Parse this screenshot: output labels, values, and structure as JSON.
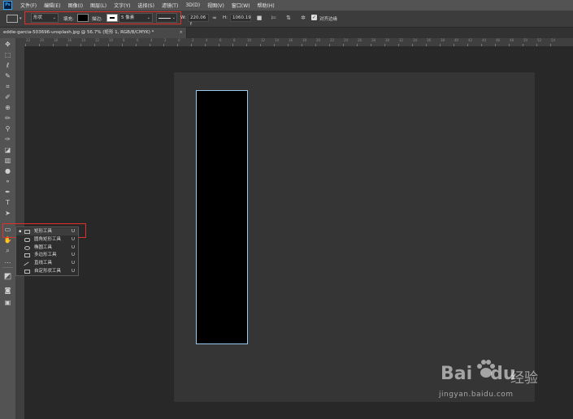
{
  "app": {
    "logo_text": "Ps"
  },
  "menubar": {
    "items": [
      "文件(F)",
      "编辑(E)",
      "图像(I)",
      "图层(L)",
      "文字(Y)",
      "选择(S)",
      "滤镜(T)",
      "3D(D)",
      "视图(V)",
      "窗口(W)",
      "帮助(H)"
    ]
  },
  "options": {
    "mode": "形状",
    "fill_label": "填充:",
    "stroke_label": "描边:",
    "stroke_width": "5 像素",
    "w_label": "W:",
    "w_value": "220.06 f",
    "h_label": "H:",
    "h_value": "1060.19",
    "align_edges_label": "对齐边缘",
    "fill_color": "#000000",
    "stroke_color": "#ffffff"
  },
  "tab": {
    "title": "eddie-garcia-503696-unsplash.jpg @ 56.7% (矩形 1, RGB/8/CMYK) *",
    "close": "×"
  },
  "ruler": {
    "top_labels": [
      "22",
      "20",
      "18",
      "16",
      "14",
      "12",
      "10",
      "8",
      "6",
      "4",
      "2",
      "0",
      "2",
      "4",
      "6",
      "8",
      "10",
      "12",
      "14",
      "16",
      "18",
      "20",
      "22",
      "24",
      "26",
      "28",
      "30",
      "32",
      "34",
      "36",
      "38",
      "40",
      "42",
      "44",
      "46",
      "48",
      "50",
      "52",
      "54"
    ]
  },
  "flyout": {
    "items": [
      {
        "label": "矩形工具",
        "key": "U",
        "selected": true,
        "icon": "rectangle-icon"
      },
      {
        "label": "圆角矩形工具",
        "key": "U",
        "selected": false,
        "icon": "rounded-rectangle-icon"
      },
      {
        "label": "椭圆工具",
        "key": "U",
        "selected": false,
        "icon": "ellipse-icon"
      },
      {
        "label": "多边形工具",
        "key": "U",
        "selected": false,
        "icon": "polygon-icon"
      },
      {
        "label": "直线工具",
        "key": "U",
        "selected": false,
        "icon": "line-icon"
      },
      {
        "label": "自定形状工具",
        "key": "U",
        "selected": false,
        "icon": "custom-shape-icon"
      }
    ]
  },
  "watermark": {
    "logo": "Bai",
    "logo_suffix": "du",
    "text": "经验",
    "url": "jingyan.baidu.com"
  },
  "colors": {
    "shape_outline": "#9cc9ee",
    "highlight": "#e0312b",
    "panel": "#535353"
  }
}
